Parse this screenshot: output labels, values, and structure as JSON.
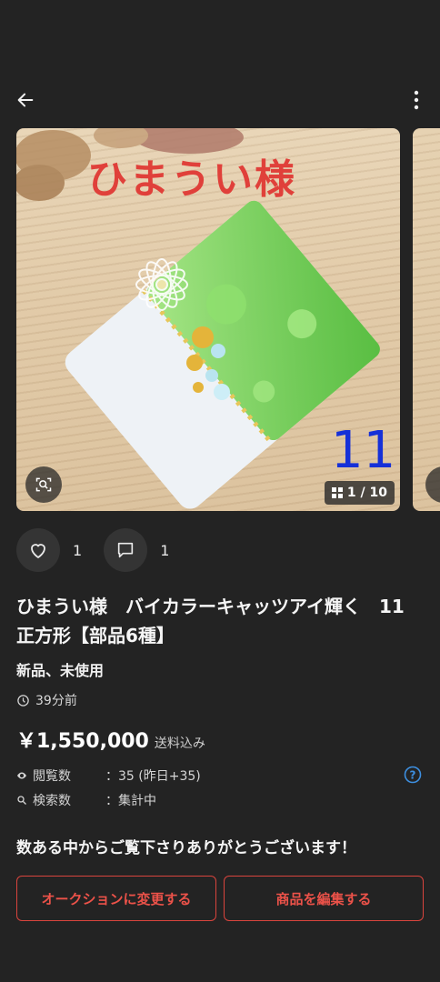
{
  "header": {
    "back_icon": "arrow-left-icon",
    "more_icon": "more-vertical-icon"
  },
  "gallery": {
    "caption": "ひまうい様",
    "number_label": "11",
    "counter": "1 / 10",
    "counter_icon": "grid-icon",
    "lens_icon": "image-search-icon"
  },
  "social": {
    "like_count": "1",
    "comment_count": "1",
    "like_icon": "heart-icon",
    "comment_icon": "comment-icon"
  },
  "product": {
    "title": "ひまうい様　バイカラーキャッツアイ輝く　11　正方形【部品6種】",
    "condition": "新品、未使用",
    "posted": "39分前",
    "price": "￥1,550,000",
    "shipping": "送料込み"
  },
  "stats": {
    "views_label": "閲覧数",
    "views_value": "：35 (昨日+35)",
    "search_label": "検索数",
    "search_value": "：集計中"
  },
  "message": "数ある中からご覧下さりありがとうございます！",
  "buttons": {
    "auction": "オークションに変更する",
    "edit": "商品を編集する"
  },
  "colors": {
    "accent": "#d9443d",
    "background": "#232323",
    "help": "#3d8fe0"
  }
}
